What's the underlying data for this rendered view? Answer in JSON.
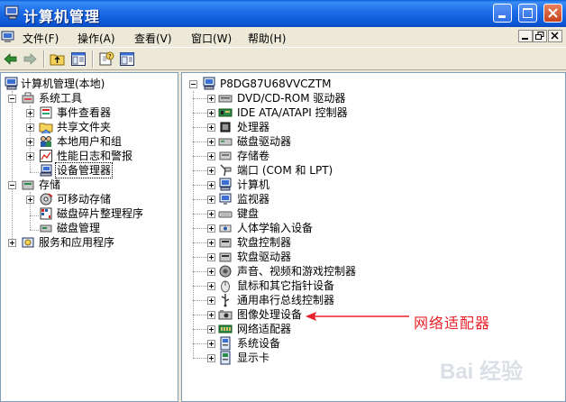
{
  "window": {
    "title": "计算机管理"
  },
  "menu": [
    "文件(F)",
    "操作(A)",
    "查看(V)",
    "窗口(W)",
    "帮助(H)"
  ],
  "left_tree": [
    {
      "label": "计算机管理(本地)",
      "icon": "computer-management-icon"
    },
    {
      "label": "系统工具",
      "icon": "tools-icon"
    },
    {
      "label": "事件查看器",
      "icon": "event-viewer-icon"
    },
    {
      "label": "共享文件夹",
      "icon": "shared-folder-icon"
    },
    {
      "label": "本地用户和组",
      "icon": "users-icon"
    },
    {
      "label": "性能日志和警报",
      "icon": "performance-icon"
    },
    {
      "label": "设备管理器",
      "icon": "device-manager-icon"
    },
    {
      "label": "存储",
      "icon": "storage-icon"
    },
    {
      "label": "可移动存储",
      "icon": "removable-storage-icon"
    },
    {
      "label": "磁盘碎片整理程序",
      "icon": "defrag-icon"
    },
    {
      "label": "磁盘管理",
      "icon": "disk-management-icon"
    },
    {
      "label": "服务和应用程序",
      "icon": "services-icon"
    }
  ],
  "right_tree": {
    "root": "P8DG87U68VVCZTM",
    "items": [
      "DVD/CD-ROM 驱动器",
      "IDE ATA/ATAPI 控制器",
      "处理器",
      "磁盘驱动器",
      "存储卷",
      "端口 (COM 和 LPT)",
      "计算机",
      "监视器",
      "键盘",
      "人体学输入设备",
      "软盘控制器",
      "软盘驱动器",
      "声音、视频和游戏控制器",
      "鼠标和其它指针设备",
      "通用串行总线控制器",
      "图像处理设备",
      "网络适配器",
      "系统设备",
      "显示卡"
    ]
  },
  "annotation": {
    "text": "网络适配器",
    "color": "#e8202a"
  },
  "watermark": "Bai 经验"
}
